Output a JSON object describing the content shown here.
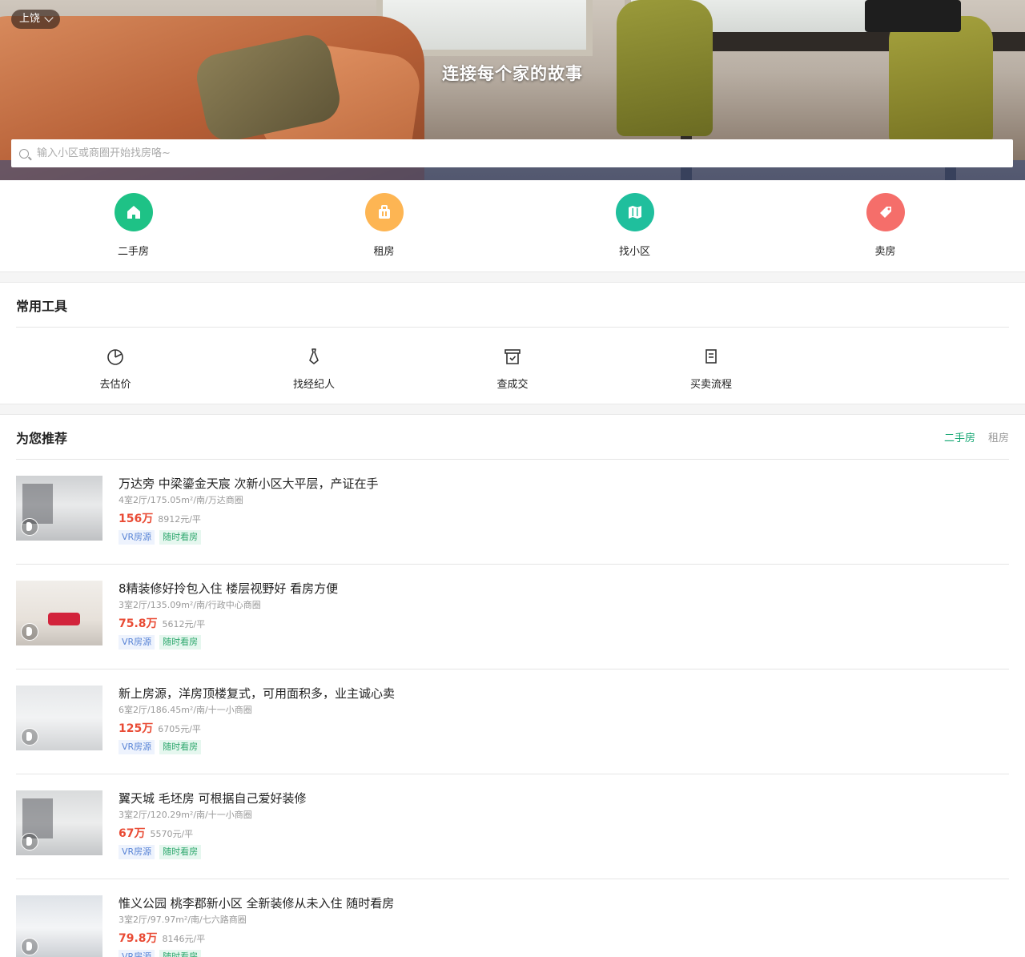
{
  "hero": {
    "city": "上饶",
    "slogan": "连接每个家的故事",
    "search_placeholder": "输入小区或商圈开始找房咯~"
  },
  "main_nav": [
    {
      "label": "二手房",
      "icon": "house-icon",
      "color": "#1ec286"
    },
    {
      "label": "租房",
      "icon": "suitcase-icon",
      "color": "#fdb553"
    },
    {
      "label": "找小区",
      "icon": "map-icon",
      "color": "#1fbf9d"
    },
    {
      "label": "卖房",
      "icon": "tag-icon",
      "color": "#f56e6a"
    }
  ],
  "tools": {
    "title": "常用工具",
    "items": [
      {
        "label": "去估价",
        "icon": "pie-chart-icon"
      },
      {
        "label": "找经纪人",
        "icon": "tie-icon"
      },
      {
        "label": "查成交",
        "icon": "archive-check-icon"
      },
      {
        "label": "买卖流程",
        "icon": "document-icon"
      }
    ]
  },
  "recommend": {
    "title": "为您推荐",
    "tab_active": "二手房",
    "tab_inactive": "租房",
    "active_color": "#13a672"
  },
  "listings": [
    {
      "title": "万达旁 中梁鎏金天宸 次新小区大平层，产证在手",
      "meta": "4室2厅/175.05m²/南/万达商圈",
      "price": "156万",
      "unit_price": "8912元/平",
      "tag1": "VR房源",
      "tag2": "随时看房"
    },
    {
      "title": "8精装修好拎包入住 楼层视野好 看房方便",
      "meta": "3室2厅/135.09m²/南/行政中心商圈",
      "price": "75.8万",
      "unit_price": "5612元/平",
      "tag1": "VR房源",
      "tag2": "随时看房"
    },
    {
      "title": "新上房源，洋房顶楼复式，可用面积多，业主诚心卖",
      "meta": "6室2厅/186.45m²/南/十一小商圈",
      "price": "125万",
      "unit_price": "6705元/平",
      "tag1": "VR房源",
      "tag2": "随时看房"
    },
    {
      "title": "翼天城 毛坯房 可根据自己爱好装修",
      "meta": "3室2厅/120.29m²/南/十一小商圈",
      "price": "67万",
      "unit_price": "5570元/平",
      "tag1": "VR房源",
      "tag2": "随时看房"
    },
    {
      "title": "惟义公园 桃李郡新小区 全新装修从未入住 随时看房",
      "meta": "3室2厅/97.97m²/南/七六路商圈",
      "price": "79.8万",
      "unit_price": "8146元/平",
      "tag1": "VR房源",
      "tag2": "随时看房"
    }
  ]
}
